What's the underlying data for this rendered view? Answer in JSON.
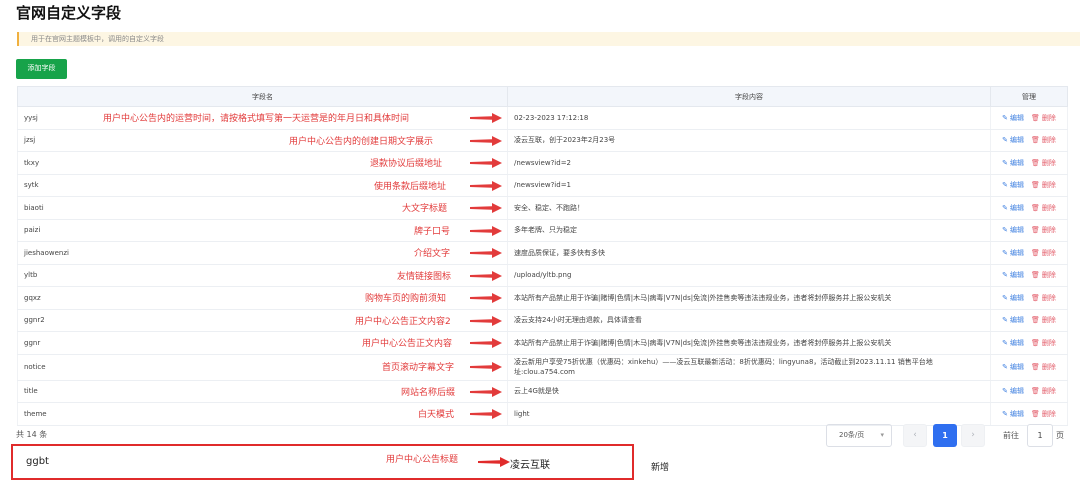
{
  "page": {
    "title": "官网自定义字段",
    "tip": "用于在官网主题模板中，调用的自定义字段",
    "add_button": "添加字段",
    "colors": {
      "primary": "#2f6ff0",
      "success": "#17a34a",
      "danger": "#e35d6a",
      "annotation": "#e23b3b"
    }
  },
  "table": {
    "headers": [
      "字段名",
      "字段内容",
      "管理"
    ],
    "edit_label": "编辑",
    "delete_label": "删除",
    "rows": [
      {
        "name": "yysj",
        "value": "02-23-2023 17:12:18",
        "note": "用户中心公告内的运营时间，请按格式填写第一天运营是的年月日和具体时间"
      },
      {
        "name": "jzsj",
        "value": "凌云互联，创于2023年2月23号",
        "note": "用户中心公告内的创建日期文字展示"
      },
      {
        "name": "tkxy",
        "value": "/newsview?id=2",
        "note": "退款协议后缀地址"
      },
      {
        "name": "sytk",
        "value": "/newsview?id=1",
        "note": "使用条款后缀地址"
      },
      {
        "name": "biaoti",
        "value": "安全、稳定、不跑路！",
        "note": "大文字标题"
      },
      {
        "name": "paizi",
        "value": "多年老牌、只为稳定",
        "note": "牌子口号"
      },
      {
        "name": "jieshaowenzi",
        "value": "速度品质保证，要多快有多快",
        "note": "介绍文字"
      },
      {
        "name": "yltb",
        "value": "/upload/yltb.png",
        "note": "友情链接图标"
      },
      {
        "name": "gqxz",
        "value": "本站所有产品禁止用于诈骗|赌博|色情|木马|病毒|V7N|ds|免流|外挂售卖等违法违规业务，违者将封停服务并上报公安机关",
        "note": "购物车页的购前须知"
      },
      {
        "name": "ggnr2",
        "value": "凌云支持24小时无理由退款，具体请查看",
        "note": "用户中心公告正文内容2"
      },
      {
        "name": "ggnr",
        "value": "本站所有产品禁止用于诈骗|赌博|色情|木马|病毒|V7N|ds|免流|外挂售卖等违法违规业务，违者将封停服务并上报公安机关",
        "note": "用户中心公告正文内容"
      },
      {
        "name": "notice",
        "value": "凌云新用户享受75折优惠（优惠码：xinkehu）——凌云互联最新活动：8折优惠码：lingyuna8，活动截止到2023.11.11 销售平台地址:clou.a754.com",
        "note": "首页滚动字幕文字"
      },
      {
        "name": "title",
        "value": "云上4G就是快",
        "note": "网站名称后缀"
      },
      {
        "name": "theme",
        "value": "light",
        "note": "白天模式"
      }
    ]
  },
  "pagination": {
    "total": "共 14 条",
    "page_size": "20条/页",
    "prev": "‹",
    "current": "1",
    "next": "›",
    "goto_label": "前往",
    "goto_value": "1",
    "goto_unit": "页"
  },
  "new_entry": {
    "key": "ggbt",
    "note": "用户中心公告标题",
    "value": "凌云互联",
    "label": "新增"
  }
}
